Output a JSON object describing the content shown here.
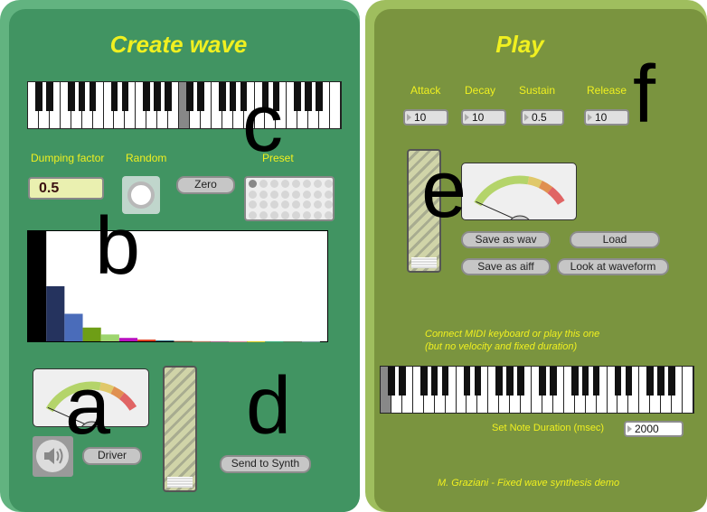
{
  "left": {
    "title": "Create wave",
    "dumping_label": "Dumping factor",
    "dumping_value": "0.5",
    "random_label": "Random",
    "zero_label": "Zero",
    "preset_label": "Preset",
    "driver_label": "Driver",
    "send_label": "Send to Synth",
    "speaker_icon": "speaker-icon",
    "keyboard_highlight_key": 14
  },
  "spectrum": {
    "values": [
      1,
      0.5,
      0.25,
      0.125,
      0.0625,
      0.031,
      0.016,
      0.008,
      0.004,
      0.002,
      0.001,
      0.0005,
      0.0003,
      0.0002,
      0.0001,
      0.0001
    ],
    "colors": [
      "#000000",
      "#25335e",
      "#4a6cba",
      "#6e9e16",
      "#9ed56e",
      "#b90fc0",
      "#e04020",
      "#1a6b7a",
      "#c09060",
      "#e0a080",
      "#c080a0",
      "#e090a0",
      "#e0d020",
      "#40b080",
      "#608060",
      "#80a0a0"
    ]
  },
  "right": {
    "title": "Play",
    "adsr": [
      {
        "label": "Attack",
        "value": "10"
      },
      {
        "label": "Decay",
        "value": "10"
      },
      {
        "label": "Sustain",
        "value": "0.5"
      },
      {
        "label": "Release",
        "value": "10"
      }
    ],
    "save_wav": "Save as wav",
    "load": "Load",
    "save_aiff": "Save as aiff",
    "look": "Look at waveform",
    "midi_line1": "Connect MIDI keyboard or play this one",
    "midi_line2": "(but no velocity and fixed duration)",
    "duration_label": "Set Note Duration (msec)",
    "duration_value": "2000",
    "credit": "M. Graziani - Fixed wave synthesis demo"
  },
  "annotations": {
    "a": "a",
    "b": "b",
    "c": "c",
    "d": "d",
    "e": "e",
    "f": "f"
  },
  "colors": {
    "left_bg": "#419462",
    "right_bg": "#7a943f",
    "title": "#f0f020"
  }
}
